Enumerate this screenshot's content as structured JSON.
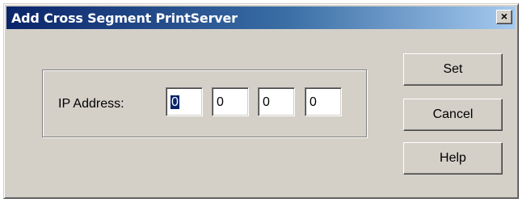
{
  "window": {
    "title": "Add Cross Segment PrintServer",
    "close_glyph": "×"
  },
  "ip": {
    "label": "IP Address:",
    "octets": [
      "0",
      "0",
      "0",
      "0"
    ]
  },
  "buttons": {
    "set": "Set",
    "cancel": "Cancel",
    "help": "Help"
  },
  "colors": {
    "dialog_face": "#d4d0c8",
    "title_active": "#0a246a",
    "selection": "#0a246a"
  },
  "icons": {
    "close": "close-icon"
  }
}
